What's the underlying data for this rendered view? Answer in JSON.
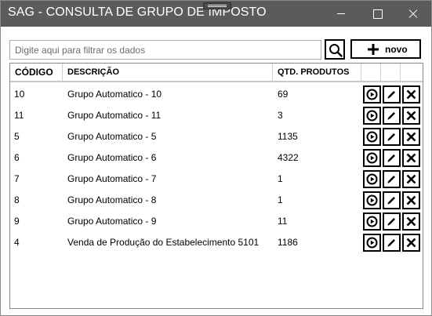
{
  "window": {
    "title": "SAG - CONSULTA DE GRUPO DE IMPOSTO"
  },
  "toolbar": {
    "filter_placeholder": "Digite aqui para filtrar os dados",
    "filter_value": "",
    "search_icon": "search-icon",
    "new_label": "novo",
    "new_icon": "plus-icon"
  },
  "grid": {
    "columns": {
      "codigo": "CÓDIGO",
      "descricao": "DESCRIÇÃO",
      "qtd_produtos": "QTD. PRODUTOS"
    },
    "action_icons": [
      "play-circle-icon",
      "pencil-icon",
      "x-icon"
    ],
    "rows": [
      {
        "codigo": "10",
        "descricao": "Grupo Automatico - 10",
        "qtd": "69"
      },
      {
        "codigo": "11",
        "descricao": "Grupo Automatico - 11",
        "qtd": "3"
      },
      {
        "codigo": "5",
        "descricao": "Grupo Automatico - 5",
        "qtd": "1135"
      },
      {
        "codigo": "6",
        "descricao": "Grupo Automatico - 6",
        "qtd": "4322"
      },
      {
        "codigo": "7",
        "descricao": "Grupo Automatico - 7",
        "qtd": "1"
      },
      {
        "codigo": "8",
        "descricao": "Grupo Automatico - 8",
        "qtd": "1"
      },
      {
        "codigo": "9",
        "descricao": "Grupo Automatico - 9",
        "qtd": "11"
      },
      {
        "codigo": "4",
        "descricao": "Venda de Produção do Estabelecimento 5101",
        "qtd": "1186"
      }
    ]
  },
  "colors": {
    "titlebar": "#5b5b5b",
    "title_text": "#ffffff",
    "border": "#000000"
  }
}
